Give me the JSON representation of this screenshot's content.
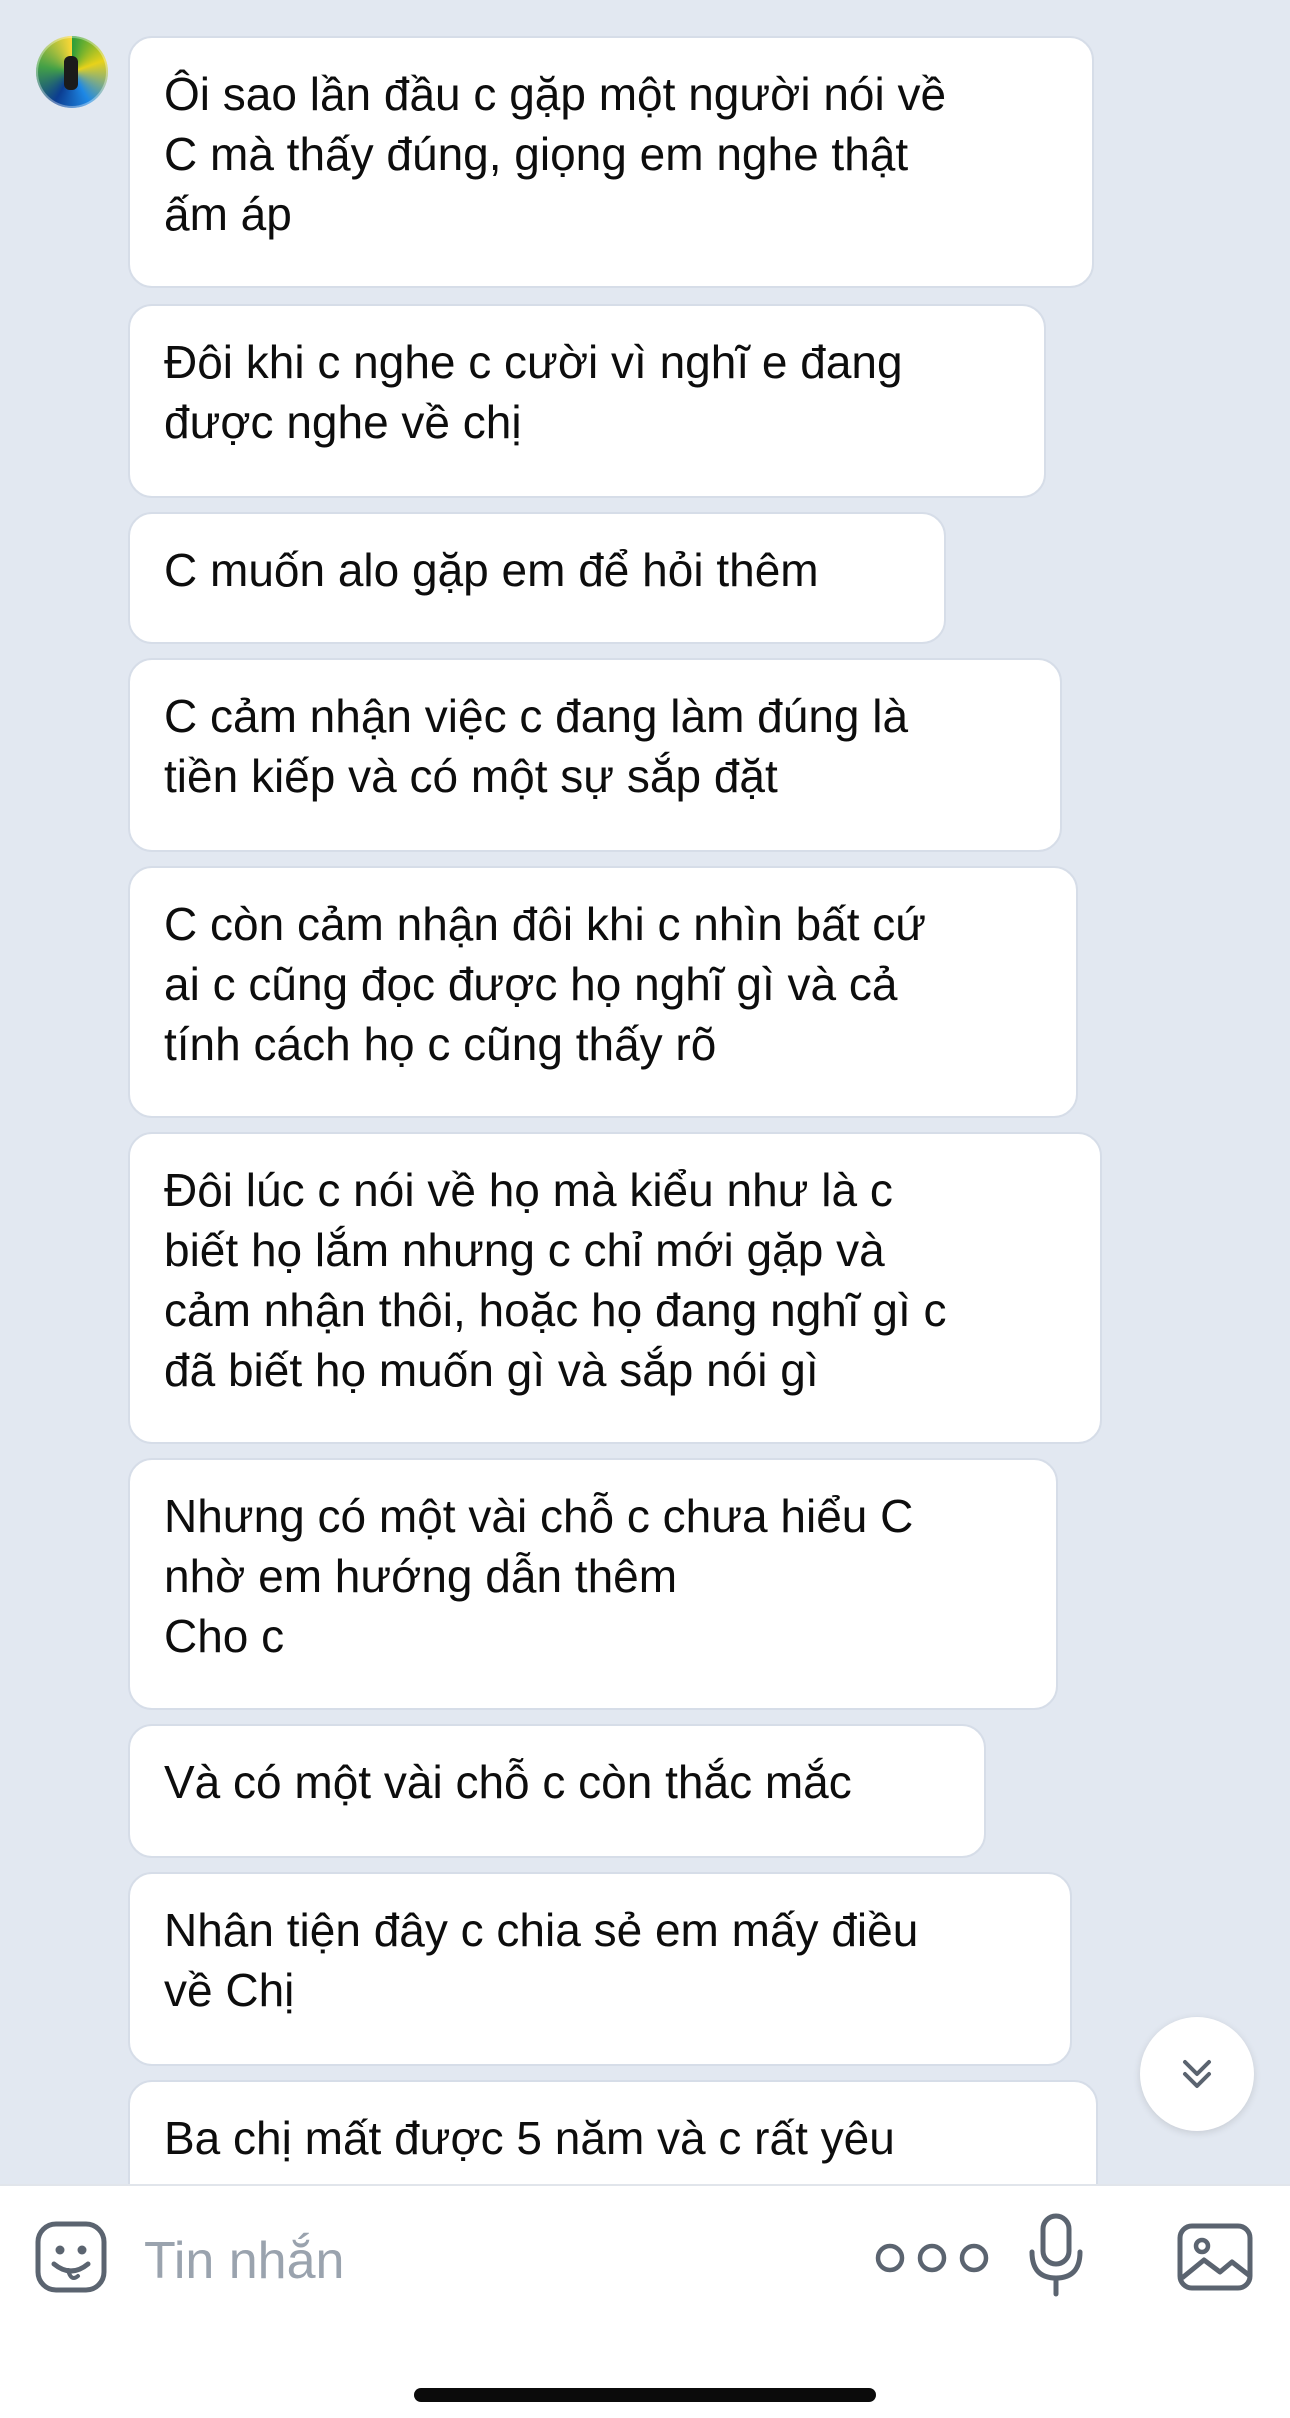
{
  "messages": [
    "Ôi sao lần đầu c gặp một người nói về\nC mà thấy đúng, giọng em nghe thật\nấm áp",
    "Đôi khi c nghe c cười vì nghĩ e đang\nđược nghe về chị",
    "C muốn alo gặp em để hỏi thêm",
    "C cảm nhận việc c đang làm đúng là\ntiền kiếp và có một sự sắp đặt",
    "C còn cảm nhận đôi khi c nhìn bất cứ\nai c cũng đọc được họ nghĩ gì và cả\ntính cách họ c cũng thấy rõ",
    "Đôi lúc c nói về họ mà kiểu như là c\nbiết họ lắm nhưng c chỉ mới gặp và\ncảm nhận thôi, hoặc họ đang nghĩ gì c\nđã biết họ muốn gì và sắp nói gì",
    "Nhưng có một vài chỗ c chưa hiểu C\nnhờ em hướng dẫn thêm\nCho c",
    "Và có một vài chỗ c còn thắc mắc",
    "Nhân tiện đây c chia sẻ em mấy điều\nvề Chị",
    "Ba chị mất được 5 năm và c rất yêu"
  ],
  "composer": {
    "placeholder": "Tin nhắn"
  },
  "icons": {
    "sticker": "sticker-icon",
    "more": "more-icon",
    "mic": "microphone-icon",
    "image": "image-icon",
    "scroll": "chevron-double-down-icon"
  },
  "colors": {
    "background": "#e2e8f1",
    "bubble": "#ffffff",
    "text": "#0d0d0d",
    "placeholder": "#9aa3ae",
    "icon": "#5b6470"
  }
}
